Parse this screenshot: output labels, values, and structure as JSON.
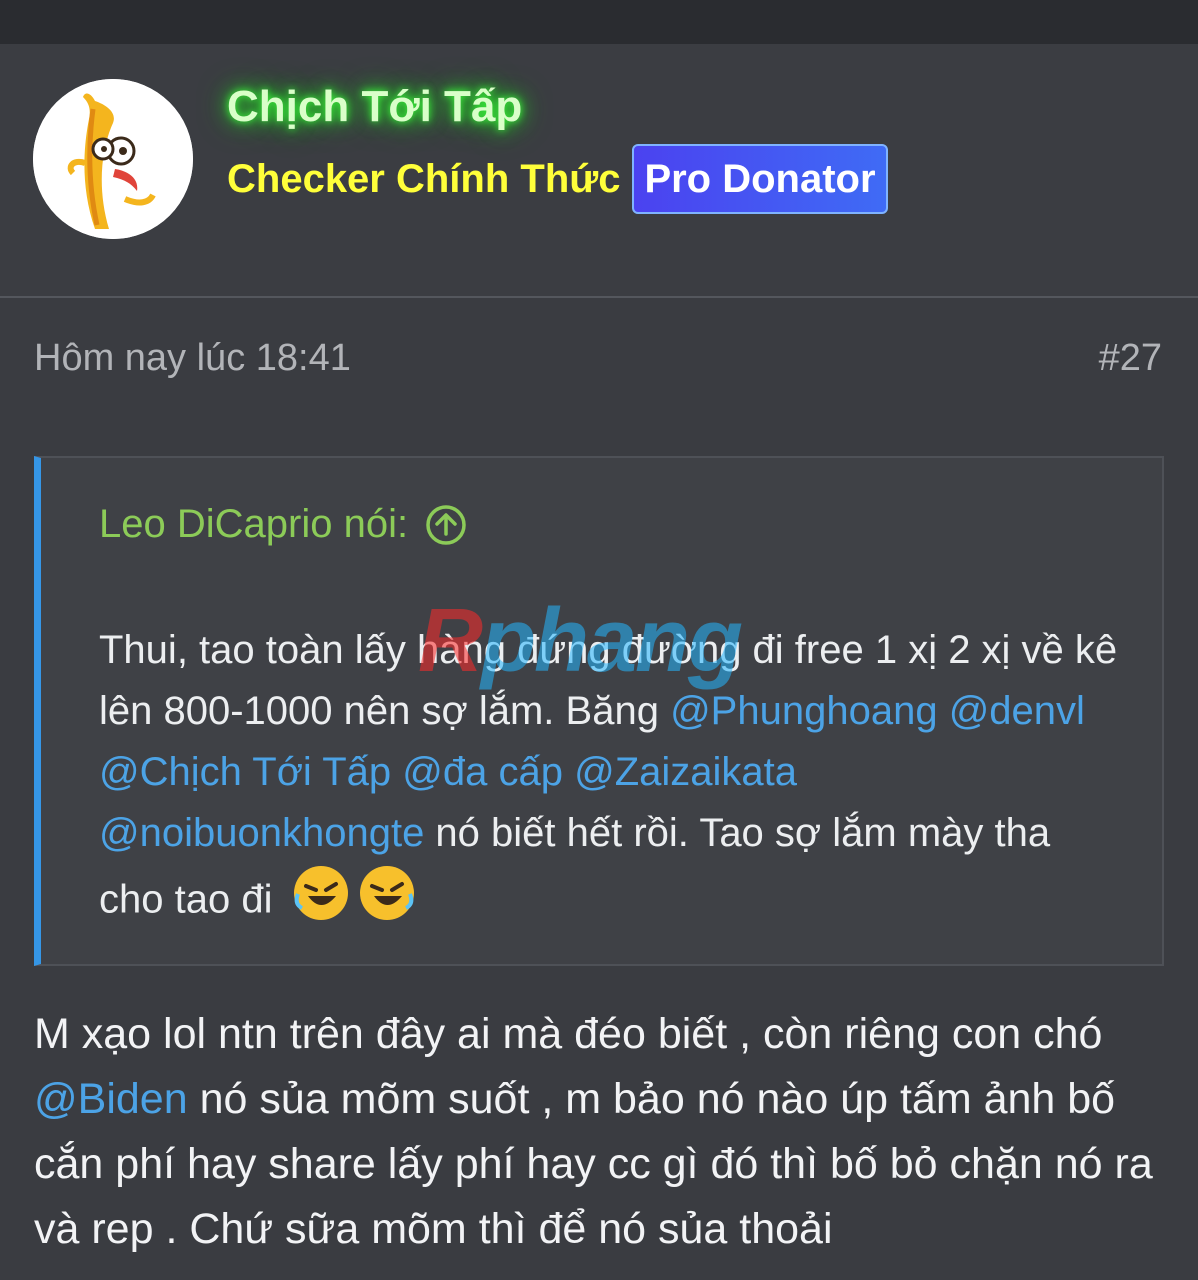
{
  "user": {
    "name": "Chịch Tới Tấp",
    "title": "Checker Chính Thức",
    "badge": "Pro Donator"
  },
  "post": {
    "date": "Hôm nay lúc 18:41",
    "number": "#27"
  },
  "quote": {
    "attribution": "Leo DiCaprio nói:",
    "text1": "Thui, tao toàn lấy hàng đứng đường đi free 1 xị 2 xị về kê lên 800-1000 nên sợ lắm. Băng ",
    "mention1": "@Phunghoang",
    "mention2": "@denvl",
    "mention3": "@Chịch Tới Tấp",
    "mention4": "@đa cấp",
    "mention5": "@Zaizaikata",
    "mention6": "@noibuonkhongte",
    "text2": " nó biết hết rồi. Tao sợ lắm mày tha cho tao đi "
  },
  "reply": {
    "text1": "M xạo lol ntn trên đây ai mà đéo biết , còn riêng con chó ",
    "mention": "@Biden",
    "text2": " nó sủa mõm suốt , m bảo nó nào úp tấm ảnh bố cắn phí hay share lấy phí hay cc gì đó thì bố bỏ chặn nó ra và rep . Chứ sữa mõm thì để nó sủa thoải"
  },
  "watermark": {
    "part1": "R",
    "part2": "phang"
  }
}
